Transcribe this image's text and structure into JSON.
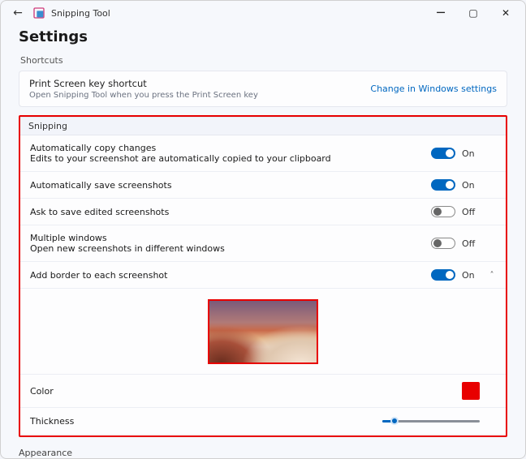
{
  "window": {
    "app_name": "Snipping Tool",
    "page_title": "Settings"
  },
  "sections": {
    "shortcuts_label": "Shortcuts",
    "snipping_label": "Snipping",
    "appearance_label": "Appearance"
  },
  "shortcut_card": {
    "title": "Print Screen key shortcut",
    "subtitle": "Open Snipping Tool when you press the Print Screen key",
    "link": "Change in Windows settings"
  },
  "rows": {
    "auto_copy": {
      "title": "Automatically copy changes",
      "subtitle": "Edits to your screenshot are automatically copied to your clipboard",
      "state": "On"
    },
    "auto_save": {
      "title": "Automatically save screenshots",
      "state": "On"
    },
    "ask_save": {
      "title": "Ask to save edited screenshots",
      "state": "Off"
    },
    "multi_win": {
      "title": "Multiple windows",
      "subtitle": "Open new screenshots in different windows",
      "state": "Off"
    },
    "add_border": {
      "title": "Add border to each screenshot",
      "state": "On"
    },
    "color_label": "Color",
    "thickness_label": "Thickness"
  },
  "border": {
    "color": "#e80000"
  }
}
